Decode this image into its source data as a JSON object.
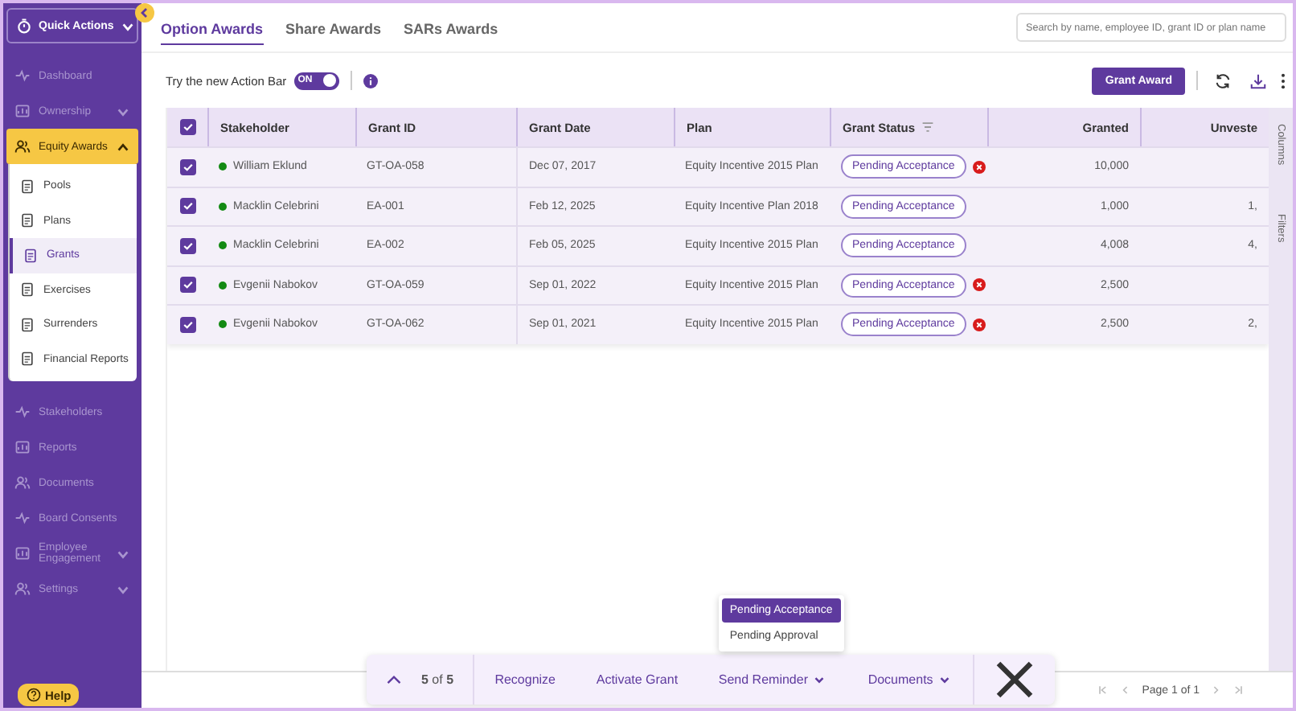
{
  "sidebar": {
    "quick_actions": {
      "label": "Quick Actions",
      "expanded": false
    },
    "items": [
      {
        "label": "Dashboard",
        "selected": false
      },
      {
        "label": "Ownership",
        "selected": false,
        "expanded": false
      },
      {
        "label": "Equity Awards",
        "selected": true,
        "expanded": true,
        "children": [
          {
            "label": "Pools",
            "selected": false
          },
          {
            "label": "Plans",
            "selected": false
          },
          {
            "label": "Grants",
            "selected": true
          },
          {
            "label": "Exercises",
            "selected": false
          },
          {
            "label": "Surrenders",
            "selected": false
          },
          {
            "label": "Financial Reports",
            "selected": false
          }
        ]
      },
      {
        "label": "Stakeholders",
        "selected": false
      },
      {
        "label": "Reports",
        "selected": false
      },
      {
        "label": "Documents",
        "selected": false
      },
      {
        "label": "Board Consents",
        "selected": false
      },
      {
        "label": "Employee Engagement",
        "selected": false,
        "expanded": false
      },
      {
        "label": "Settings",
        "selected": false,
        "expanded": false
      }
    ],
    "help": "Help"
  },
  "tabs": [
    {
      "label": "Option Awards",
      "selected": true
    },
    {
      "label": "Share Awards",
      "selected": false
    },
    {
      "label": "SARs Awards",
      "selected": false
    }
  ],
  "search": {
    "placeholder": "Search by name, employee ID, grant ID or plan name"
  },
  "action_bar_toggle": {
    "label": "Try the new Action Bar",
    "on": true,
    "state_text": "ON"
  },
  "grant_award_button": "Grant Award",
  "table": {
    "all_checked": true,
    "columns": [
      "Stakeholder",
      "Grant ID",
      "Grant Date",
      "Plan",
      "Grant Status",
      "Granted",
      "Unveste"
    ],
    "rows": [
      {
        "checked": true,
        "color": "#138a13",
        "stakeholder": "William Eklund",
        "grant_id": "GT-OA-058",
        "grant_date": "Dec 07, 2017",
        "plan": "Equity Incentive 2015 Plan",
        "status": "Pending Acceptance",
        "error": true,
        "granted": "10,000"
      },
      {
        "checked": true,
        "color": "#138a13",
        "stakeholder": "Macklin Celebrini",
        "grant_id": "EA-001",
        "grant_date": "Feb 12, 2025",
        "plan": "Equity Incentive Plan 2018",
        "status": "Pending Acceptance",
        "error": false,
        "granted": "1,000",
        "unvested": "1,"
      },
      {
        "checked": true,
        "color": "#138a13",
        "stakeholder": "Macklin Celebrini",
        "grant_id": "EA-002",
        "grant_date": "Feb 05, 2025",
        "plan": "Equity Incentive 2015 Plan",
        "status": "Pending Acceptance",
        "error": false,
        "granted": "4,008",
        "unvested": "4,"
      },
      {
        "checked": true,
        "color": "#138a13",
        "stakeholder": "Evgenii Nabokov",
        "grant_id": "GT-OA-059",
        "grant_date": "Sep 01, 2022",
        "plan": "Equity Incentive 2015 Plan",
        "status": "Pending Acceptance",
        "error": true,
        "granted": "2,500"
      },
      {
        "checked": true,
        "color": "#138a13",
        "stakeholder": "Evgenii Nabokov",
        "grant_id": "GT-OA-062",
        "grant_date": "Sep 01, 2021",
        "plan": "Equity Incentive 2015 Plan",
        "status": "Pending Acceptance",
        "error": true,
        "granted": "2,500",
        "unvested": "2,"
      }
    ]
  },
  "side_panel": [
    "Columns",
    "Filters"
  ],
  "selection_bar": {
    "count": "**5** of **5**",
    "actions": [
      {
        "label": "Recognize",
        "kind": "plain"
      },
      {
        "label": "Activate Grant",
        "kind": "plain"
      },
      {
        "label": "Send Reminder",
        "kind": "menu",
        "expanded": true,
        "options": [
          {
            "label": "Pending Acceptance",
            "selected": true
          },
          {
            "label": "Pending Approval",
            "selected": false
          }
        ]
      },
      {
        "label": "Documents",
        "kind": "menu"
      }
    ]
  },
  "pagination": {
    "label": "Page 1 of 1"
  }
}
